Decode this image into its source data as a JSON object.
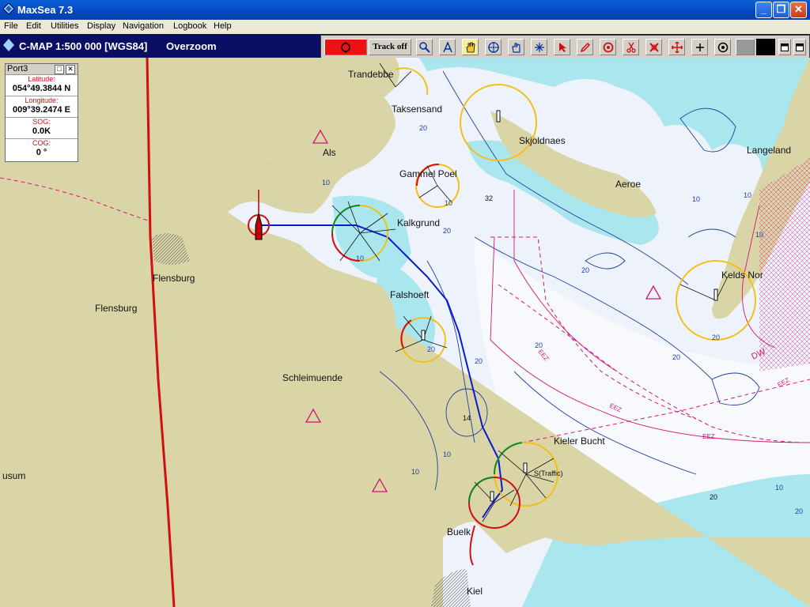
{
  "window": {
    "title": "MaxSea 7.3",
    "min_label": "_",
    "max_label": "❐",
    "close_label": "✕"
  },
  "menu": [
    "File",
    "Edit",
    "Utilities",
    "Display",
    "Navigation",
    "Logbook",
    "Help"
  ],
  "chart_header": {
    "title": "C-MAP  1:500 000 [WGS84]",
    "overzoom": "Overzoom"
  },
  "toolbar": {
    "track_label": "Track off",
    "tools": [
      "record-icon",
      "track-toggle",
      "zoom-icon",
      "route-icon",
      "pan-hand-icon",
      "center-icon",
      "grab-icon",
      "compass-icon",
      "pointer-icon",
      "pencil-icon",
      "target-icon",
      "scissors-icon",
      "marks-icon",
      "move-icon",
      "cross-icon",
      "circle-icon"
    ]
  },
  "panel": {
    "title": "Port3",
    "latitude_label": "Latitude:",
    "latitude": "054°49.3844 N",
    "longitude_label": "Longitude:",
    "longitude": "009°39.2474 E",
    "sog_label": "SOG:",
    "sog": "0.0K",
    "cog_label": "COG:",
    "cog": "0 °"
  },
  "map_labels": {
    "trandebbe": "Trandebbe",
    "taksensand": "Taksensand",
    "skjoldnaes": "Skjoldnaes",
    "als": "Als",
    "langeland": "Langeland",
    "gammel_poel": "Gammel Poel",
    "aeroe": "Aeroe",
    "kalkgrund": "Kalkgrund",
    "flensburg_1": "Flensburg",
    "flensburg_2": "Flensburg",
    "falshoeft": "Falshoeft",
    "keldsnor": "Kelds Nor",
    "schleimuende": "Schleimuende",
    "kieler_bucht": "Kieler Bucht",
    "traffic": "S(Traffic)",
    "husum": "usum",
    "buelk": "Buelk",
    "kiel": "Kiel"
  },
  "depths": [
    "10",
    "10",
    "20",
    "20",
    "32",
    "20",
    "20",
    "10",
    "10",
    "20",
    "20",
    "14",
    "10",
    "10",
    "20",
    "10",
    "20",
    "10",
    "20",
    "10",
    "20"
  ],
  "eez_labels": [
    "EEZ",
    "EEZ",
    "EEZ",
    "EEZ",
    "DW"
  ],
  "colors": {
    "land": "#d9d5a7",
    "shallow": "#aae6ee",
    "water": "#eef3fb",
    "route": "#0a1ad0",
    "border": "#d01010"
  }
}
